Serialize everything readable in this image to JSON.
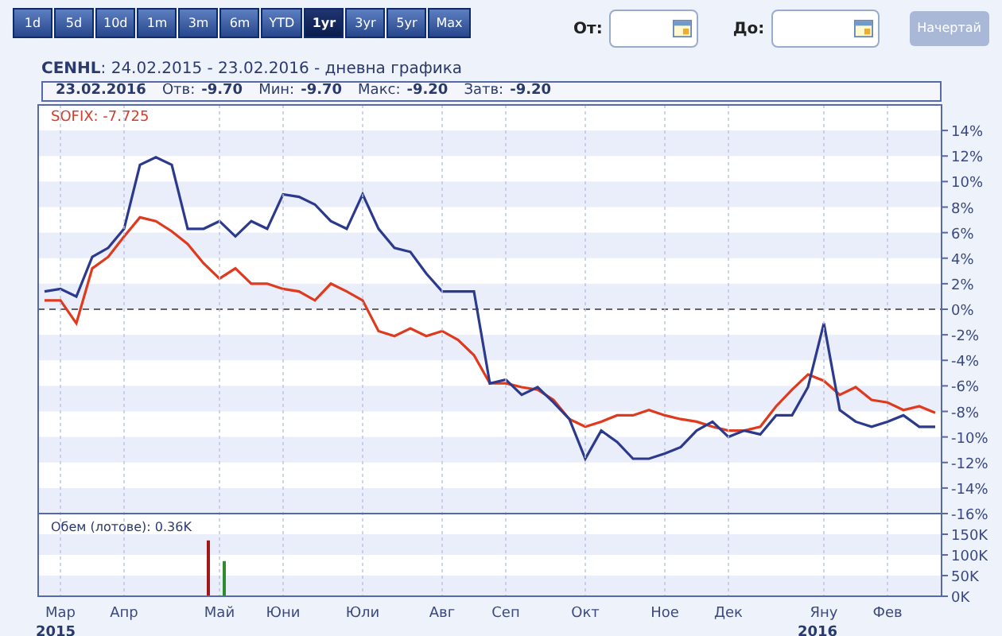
{
  "range_buttons": [
    {
      "label": "1d",
      "selected": false
    },
    {
      "label": "5d",
      "selected": false
    },
    {
      "label": "10d",
      "selected": false
    },
    {
      "label": "1m",
      "selected": false
    },
    {
      "label": "3m",
      "selected": false
    },
    {
      "label": "6m",
      "selected": false
    },
    {
      "label": "YTD",
      "selected": false
    },
    {
      "label": "1yr",
      "selected": true
    },
    {
      "label": "3yr",
      "selected": false
    },
    {
      "label": "5yr",
      "selected": false
    },
    {
      "label": "Max",
      "selected": false
    }
  ],
  "date_from": {
    "label": "От:"
  },
  "date_to": {
    "label": "До:"
  },
  "draw_button": {
    "label": "Начертай",
    "disabled": true
  },
  "header": {
    "symbol": "CENHL",
    "text": ": 24.02.2015 - 23.02.2016 - дневна графика"
  },
  "info_bar": {
    "date": "23.02.2016",
    "fields": [
      {
        "label": "Отв:",
        "value": "-9.70"
      },
      {
        "label": "Мин:",
        "value": "-9.70"
      },
      {
        "label": "Макс:",
        "value": "-9.20"
      },
      {
        "label": "Затв:",
        "value": "-9.20"
      }
    ]
  },
  "price_chart": {
    "legend": "SOFIX: -7.725",
    "chart_data": {
      "type": "line",
      "series": [
        {
          "color": "#2b3a8c",
          "values": [
            1.4,
            1.6,
            1.0,
            4.1,
            4.8,
            6.3,
            11.3,
            11.9,
            11.3,
            6.3,
            6.3,
            6.9,
            5.7,
            6.9,
            6.3,
            9.0,
            8.8,
            8.2,
            6.9,
            6.3,
            9.0,
            6.3,
            4.8,
            4.5,
            2.8,
            1.4,
            1.4,
            1.4,
            -5.8,
            -5.5,
            -6.7,
            -6.1,
            -7.3,
            -8.6,
            -11.7,
            -9.5,
            -10.4,
            -11.7,
            -11.7,
            -11.3,
            -10.8,
            -9.5,
            -8.8,
            -10.0,
            -9.5,
            -9.8,
            -8.3,
            -8.3,
            -6.1,
            -1.1,
            -7.9,
            -8.8,
            -9.2,
            -8.8,
            -8.3,
            -9.2,
            -9.2
          ]
        },
        {
          "color": "#e03a1e",
          "values": [
            0.7,
            0.7,
            -1.1,
            3.2,
            4.1,
            5.7,
            7.2,
            6.9,
            6.1,
            5.1,
            3.6,
            2.4,
            3.2,
            2.0,
            2.0,
            1.6,
            1.4,
            0.7,
            2.0,
            1.4,
            0.7,
            -1.7,
            -2.1,
            -1.5,
            -2.1,
            -1.7,
            -2.4,
            -3.6,
            -5.8,
            -5.8,
            -6.1,
            -6.3,
            -7.1,
            -8.6,
            -9.2,
            -8.8,
            -8.3,
            -8.3,
            -7.9,
            -8.3,
            -8.6,
            -8.8,
            -9.2,
            -9.5,
            -9.5,
            -9.2,
            -7.6,
            -6.3,
            -5.1,
            -5.6,
            -6.7,
            -6.1,
            -7.1,
            -7.3,
            -7.9,
            -7.6,
            -8.1
          ]
        }
      ],
      "ylim": [
        -16,
        16
      ],
      "yticks": [
        {
          "value": 14,
          "label": "14%"
        },
        {
          "value": 12,
          "label": "12%"
        },
        {
          "value": 10,
          "label": "10%"
        },
        {
          "value": 8,
          "label": "8%"
        },
        {
          "value": 6,
          "label": "6%"
        },
        {
          "value": 4,
          "label": "4%"
        },
        {
          "value": 2,
          "label": "2%"
        },
        {
          "value": 0,
          "label": "0%"
        },
        {
          "value": -2,
          "label": "-2%"
        },
        {
          "value": -4,
          "label": "-4%"
        },
        {
          "value": -6,
          "label": "-6%"
        },
        {
          "value": -8,
          "label": "-8%"
        },
        {
          "value": -10,
          "label": "-10%"
        },
        {
          "value": -12,
          "label": "-12%"
        },
        {
          "value": -14,
          "label": "-14%"
        },
        {
          "value": -16,
          "label": "-16%"
        }
      ]
    }
  },
  "volume_chart": {
    "title": "Обем (лотове): 0.36K",
    "chart_data": {
      "type": "bar",
      "categories": [
        null,
        "Мар",
        null,
        null,
        null,
        "Апр",
        null,
        null,
        null,
        null,
        null,
        "Май",
        null,
        null,
        null,
        "Юни",
        null,
        null,
        null,
        null,
        "Юли",
        null,
        null,
        null,
        null,
        "Авг",
        null,
        null,
        null,
        "Сеп",
        null,
        null,
        null,
        null,
        "Окт",
        null,
        null,
        null,
        null,
        "Ное",
        null,
        null,
        null,
        "Дек",
        null,
        null,
        null,
        null,
        null,
        "Яну",
        null,
        null,
        null,
        "Фев",
        null,
        null,
        null
      ],
      "series": [
        {
          "color": "#a01818",
          "values": [
            null,
            null,
            null,
            null,
            null,
            null,
            null,
            null,
            null,
            null,
            135,
            null,
            null,
            null,
            null,
            null,
            null,
            null,
            null,
            null,
            null,
            null,
            null,
            null,
            null,
            null,
            null,
            null,
            null,
            null,
            null,
            null,
            null,
            null,
            null,
            null,
            null,
            null,
            null,
            null,
            null,
            null,
            null,
            null,
            null,
            null,
            null,
            null,
            null,
            null,
            null,
            null,
            null,
            null,
            null,
            null,
            null
          ]
        },
        {
          "color": "#2e8b2e",
          "values": [
            null,
            null,
            null,
            null,
            null,
            null,
            null,
            null,
            null,
            null,
            null,
            85,
            null,
            null,
            null,
            null,
            null,
            null,
            null,
            null,
            null,
            null,
            null,
            null,
            null,
            null,
            null,
            null,
            null,
            null,
            null,
            null,
            null,
            null,
            null,
            null,
            null,
            null,
            null,
            null,
            null,
            null,
            null,
            null,
            null,
            null,
            null,
            null,
            null,
            null,
            null,
            null,
            null,
            null,
            null,
            null,
            null
          ]
        }
      ],
      "ylim": [
        0,
        150
      ],
      "yticks": [
        {
          "value": 150,
          "label": "150K"
        },
        {
          "value": 100,
          "label": "100K"
        },
        {
          "value": 50,
          "label": "50K"
        },
        {
          "value": 0,
          "label": "0K"
        }
      ]
    }
  },
  "year_labels": [
    "2015",
    "2016"
  ]
}
